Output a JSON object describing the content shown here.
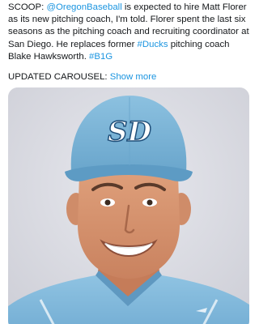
{
  "tweet": {
    "segments": [
      {
        "text": "SCOOP: ",
        "link": false
      },
      {
        "text": "@OregonBaseball",
        "link": true
      },
      {
        "text": " is expected to hire Matt Florer as its new pitching coach, I'm told. Florer spent the last six seasons as the pitching coach and recruiting coordinator at San Diego. He replaces former ",
        "link": false
      },
      {
        "text": "#Ducks",
        "link": true
      },
      {
        "text": " pitching coach Blake Hawksworth. ",
        "link": false
      },
      {
        "text": "#B1G",
        "link": true
      }
    ]
  },
  "carousel": {
    "label": "UPDATED CAROUSEL: ",
    "show_more": "Show more"
  },
  "media": {
    "alt": "Headshot of a smiling man in a light blue San Diego baseball cap and jersey",
    "cap_logo": "SD"
  },
  "colors": {
    "link": "#1b95e0",
    "text": "#14171a",
    "background": "#ffffff",
    "cap": "#7fb6d8",
    "photo_background": "#dcdde4"
  }
}
